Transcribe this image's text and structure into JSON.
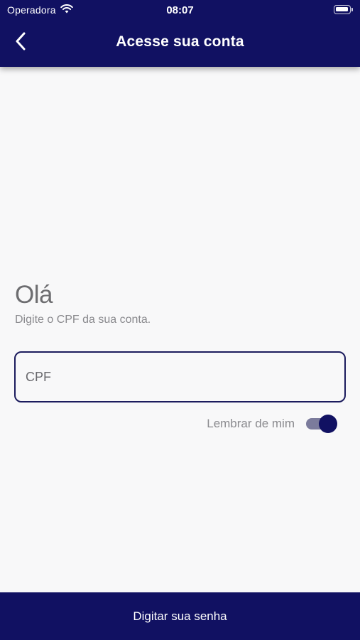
{
  "status_bar": {
    "carrier": "Operadora",
    "time": "08:07",
    "icons": [
      "wifi-icon",
      "battery-icon"
    ]
  },
  "header": {
    "title": "Acesse sua conta",
    "back_icon": "chevron-left-icon"
  },
  "main": {
    "greeting": "Olá",
    "subtitle": "Digite o CPF da sua conta.",
    "cpf_field": {
      "placeholder": "CPF",
      "value": ""
    },
    "remember": {
      "label": "Lembrar de mim",
      "enabled": true
    }
  },
  "footer": {
    "button_label": "Digitar sua senha"
  },
  "colors": {
    "brand_navy": "#111162",
    "background": "#f8f8f9",
    "text_gray": "#6d6d70",
    "toggle_track": "#7b7b9c"
  }
}
